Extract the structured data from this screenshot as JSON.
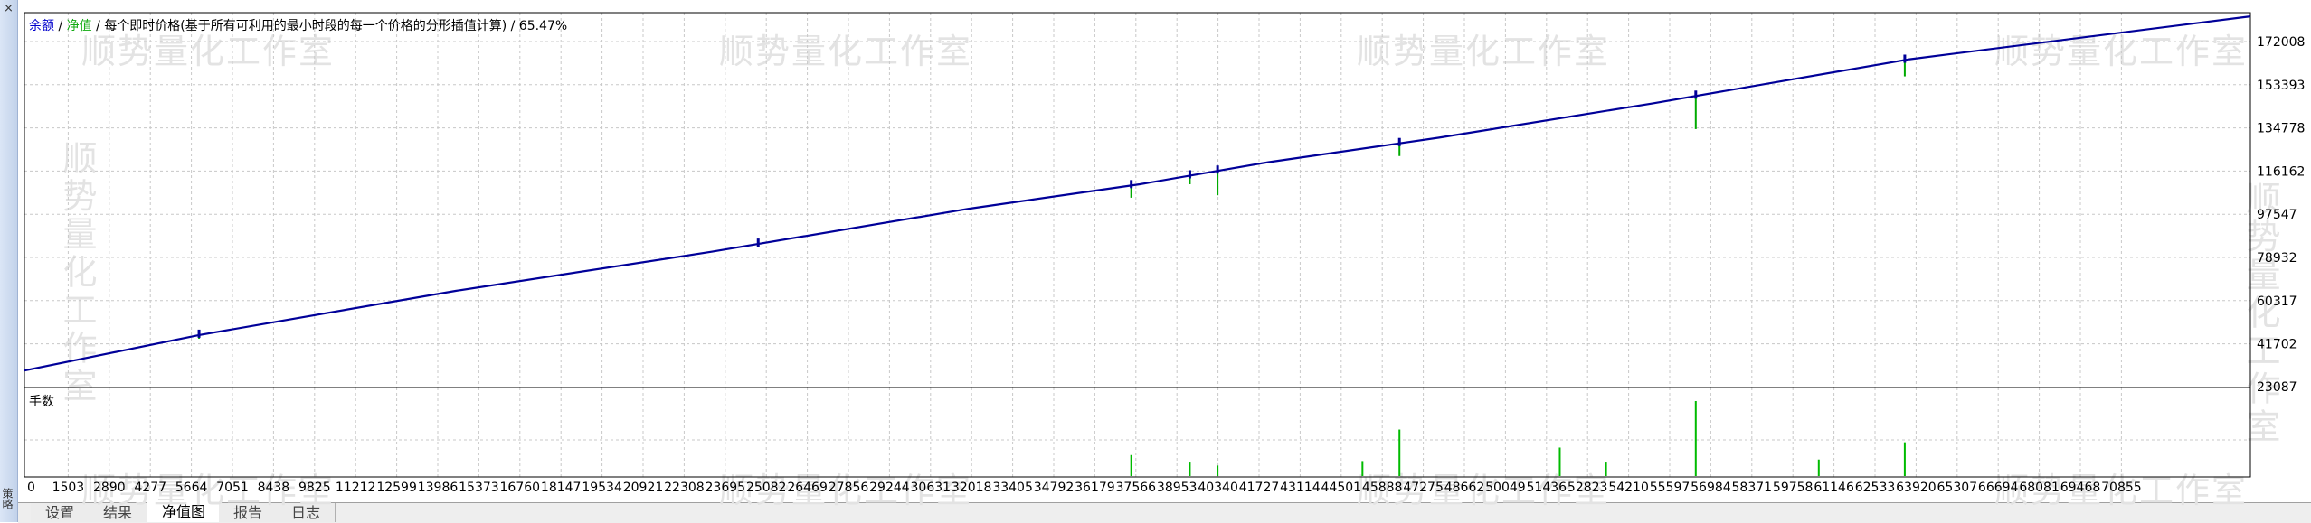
{
  "window": {
    "close_glyph": "×",
    "strip_label": "策略"
  },
  "title": {
    "balance": "余额",
    "sep": " / ",
    "equity": "净值",
    "rest": " / 每个即时价格(基于所有可利用的最小时段的每一个价格的分形插值计算) / 65.47%"
  },
  "volume_label": "手数",
  "watermark_text": "顺势量化工作室",
  "tabs": [
    {
      "label": "设置",
      "active": false
    },
    {
      "label": "结果",
      "active": false
    },
    {
      "label": "净值图",
      "active": true
    },
    {
      "label": "报告",
      "active": false
    },
    {
      "label": "日志",
      "active": false
    }
  ],
  "colors": {
    "balance": "#000099",
    "equity": "#00aa00",
    "grid": "#c8c8c8",
    "volume": "#00bb00"
  },
  "chart_data": {
    "type": "line",
    "x_tick_labels": [
      "0",
      "1503",
      "2890",
      "4277",
      "5664",
      "7051",
      "8438",
      "9825",
      "11212",
      "12599",
      "13986",
      "15373",
      "16760",
      "18147",
      "19534",
      "20921",
      "22308",
      "23695",
      "25082",
      "26469",
      "27856",
      "29244",
      "30631",
      "32018",
      "33405",
      "34792",
      "36179",
      "37566",
      "38953",
      "40340",
      "41727",
      "43114",
      "44501",
      "45888",
      "47275",
      "48662",
      "50049",
      "51436",
      "52823",
      "54210",
      "55597",
      "56984",
      "58371",
      "59758",
      "61146",
      "62533",
      "63920",
      "65307",
      "66694",
      "68081",
      "69468",
      "70855"
    ],
    "y_tick_labels": [
      "172008",
      "153393",
      "134778",
      "116162",
      "97547",
      "78932",
      "60317",
      "41702",
      "23087"
    ],
    "ylim": [
      23087,
      176000
    ],
    "xlim": [
      0,
      72200
    ],
    "grid": true,
    "series": [
      {
        "name": "余额",
        "x": [
          0,
          5664,
          13986,
          22308,
          30631,
          36179,
          40340,
          45888,
          52823,
          61146,
          72200
        ],
        "y": [
          30000,
          44500,
          62500,
          78500,
          96000,
          106000,
          115000,
          125000,
          139000,
          157000,
          174500
        ]
      },
      {
        "name": "净值",
        "x": [
          0,
          5664,
          13986,
          22308,
          30631,
          36179,
          40340,
          45888,
          52823,
          61146,
          72200
        ],
        "y": [
          30000,
          44500,
          62500,
          78500,
          96000,
          106000,
          115000,
          125000,
          139000,
          157000,
          174500
        ]
      }
    ],
    "equity_dips": [
      {
        "x": 5664,
        "low": 43000
      },
      {
        "x": 23800,
        "low": 82000
      },
      {
        "x": 35900,
        "low": 100500
      },
      {
        "x": 37800,
        "low": 106000
      },
      {
        "x": 38700,
        "low": 101500
      },
      {
        "x": 44600,
        "low": 117500
      },
      {
        "x": 54210,
        "low": 128500
      },
      {
        "x": 60990,
        "low": 150000
      }
    ],
    "volume_bars": [
      {
        "x": 35900,
        "v": 0.28
      },
      {
        "x": 37800,
        "v": 0.18
      },
      {
        "x": 38700,
        "v": 0.14
      },
      {
        "x": 43400,
        "v": 0.2
      },
      {
        "x": 44600,
        "v": 0.62
      },
      {
        "x": 49800,
        "v": 0.38
      },
      {
        "x": 51300,
        "v": 0.18
      },
      {
        "x": 54210,
        "v": 1.0
      },
      {
        "x": 58200,
        "v": 0.22
      },
      {
        "x": 60990,
        "v": 0.45
      }
    ]
  }
}
